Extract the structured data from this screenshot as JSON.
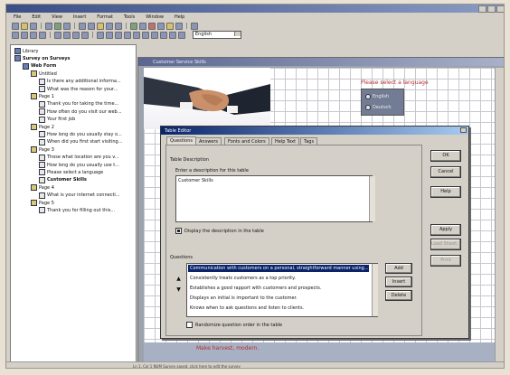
{
  "window": {
    "title": ""
  },
  "menu": [
    "File",
    "Edit",
    "View",
    "Insert",
    "Format",
    "Tools",
    "Window",
    "Help"
  ],
  "toolbar": {
    "language": "English"
  },
  "tree": [
    {
      "label": "Library",
      "level": 0,
      "kind": "folder"
    },
    {
      "label": "Survey on Surveys",
      "level": 0,
      "kind": "survey",
      "bold": true
    },
    {
      "label": "Web Form",
      "level": 1,
      "kind": "folder",
      "bold": true
    },
    {
      "label": "Untitled",
      "level": 2,
      "kind": "page"
    },
    {
      "label": "Is there any additional informa...",
      "level": 3,
      "kind": "question"
    },
    {
      "label": "What was the reason for your...",
      "level": 3,
      "kind": "question"
    },
    {
      "label": "Page 1",
      "level": 2,
      "kind": "page"
    },
    {
      "label": "Thank you for taking the time...",
      "level": 3,
      "kind": "question"
    },
    {
      "label": "How often do you visit our web...",
      "level": 3,
      "kind": "question"
    },
    {
      "label": "Your first job",
      "level": 3,
      "kind": "question"
    },
    {
      "label": "Page 2",
      "level": 2,
      "kind": "page"
    },
    {
      "label": "How long do you usually stay o...",
      "level": 3,
      "kind": "question"
    },
    {
      "label": "When did you first start visiting...",
      "level": 3,
      "kind": "question"
    },
    {
      "label": "Page 3",
      "level": 2,
      "kind": "page"
    },
    {
      "label": "Those what location are you v...",
      "level": 3,
      "kind": "question"
    },
    {
      "label": "How long do you usually use t...",
      "level": 3,
      "kind": "question"
    },
    {
      "label": "Please select a language",
      "level": 3,
      "kind": "question"
    },
    {
      "label": "Customer Skills",
      "level": 3,
      "kind": "question",
      "bold": true
    },
    {
      "label": "Page 4",
      "level": 2,
      "kind": "page"
    },
    {
      "label": "What is your internet connecti...",
      "level": 3,
      "kind": "question"
    },
    {
      "label": "Page 5",
      "level": 2,
      "kind": "page"
    },
    {
      "label": "Thank you for filling out this...",
      "level": 3,
      "kind": "question"
    }
  ],
  "preview": {
    "title": "Customer Service Skills",
    "language_prompt": "Please select a language",
    "options": [
      "English",
      "Deutsch"
    ],
    "footer": "Make harvest, modern."
  },
  "dialog": {
    "title": "Table Editor",
    "tabs": [
      "Questions",
      "Answers",
      "Fonts and Colors",
      "Help Text",
      "Tags"
    ],
    "active_tab": 0,
    "section_label": "Table Description",
    "desc_prompt": "Enter a description for this table",
    "description": "Customer Skills",
    "display_checkbox": "Display the description in the table",
    "display_checked": true,
    "questions_label": "Questions",
    "questions": [
      "Communication with customers on a personal, straightforward manner using...",
      "Consistently treats customers as a top priority.",
      "Establishes a good rapport with customers and prospects.",
      "Displays an initial is important to the customer.",
      "Knows when to ask questions and listen to clients."
    ],
    "selected_question": 0,
    "randomize_checkbox": "Randomize question order in the table",
    "randomize_checked": false,
    "list_buttons": [
      "Add",
      "Insert",
      "Delete"
    ],
    "side_buttons": [
      {
        "label": "OK",
        "enabled": true
      },
      {
        "label": "Cancel",
        "enabled": true
      },
      {
        "label": "Help",
        "enabled": true
      },
      {
        "label": "Apply",
        "enabled": true
      },
      {
        "label": "Load Sheet...",
        "enabled": false
      },
      {
        "label": "Print",
        "enabled": false
      }
    ]
  },
  "statusbar": {
    "text": "Ln 1, Col 1  NUM  Survey saved, click here to edit the survey"
  },
  "colors": {
    "accent": "#0a246a",
    "preview_text": "#b03030",
    "dialog_bg": "#d4d0c8"
  }
}
